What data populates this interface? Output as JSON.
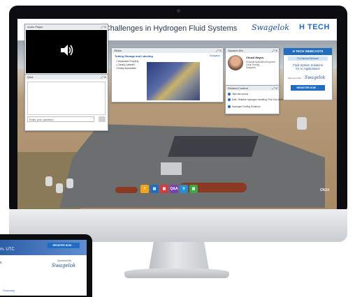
{
  "page_title": "Overcoming Operating Challenges in Hydrogen Fluid Systems",
  "brands": {
    "swagelok": "Swagelok",
    "htech": "H TECH"
  },
  "audio_window": {
    "title": "Audio Player",
    "controls": "⤢ ✕"
  },
  "chat_window": {
    "title": "Q&A",
    "controls": "⤢ ✕",
    "input_placeholder": "Enter your question"
  },
  "slides_window": {
    "title": "Slides",
    "controls": "⤢ ✕",
    "heading": "Tubing Storage and Labeling",
    "link": "Swagelok",
    "bullets": [
      "Separated Properly",
      "Clearly Labeled",
      "Easily Accessible"
    ]
  },
  "speaker_window": {
    "title": "Speaker Bio",
    "controls": "⤢ ✕",
    "name": "Chuck Hayes",
    "lines": [
      "Principal Application Engineer",
      "Clean Energy",
      "Swagelok"
    ]
  },
  "resources_window": {
    "title": "Related Content",
    "controls": "⤢ ✕",
    "items": [
      "Take the survey",
      "Safe, Reliable Hydrogen Handling: Five Dos What It Takes",
      "Hydrogen Fueling Solutions"
    ]
  },
  "ad": {
    "top": "H TECH WEBCASTS",
    "sub": "On Demand Webcast",
    "body_line1": "Fluid System Solutions",
    "body_line2": "for H₂ Applications",
    "sponsored": "Sponsored By",
    "sponsor": "Swagelok",
    "button": "REGISTER NOW →"
  },
  "toolbar": [
    "?",
    "▤",
    "▦",
    "Q&A",
    "⚲",
    "▧"
  ],
  "toolbar_colors": [
    "#f2a51a",
    "#1f6cc1",
    "#d83a3a",
    "#7a3fb0",
    "#1f8fd6",
    "#3aa845"
  ],
  "watermark": "ON24",
  "tablet": {
    "time": "m. UTC",
    "register": "REGISTER NOW →",
    "s": "s",
    "sponsored": "Sponsored By",
    "sponsor": "Swagelok",
    "summary": "Summary"
  }
}
